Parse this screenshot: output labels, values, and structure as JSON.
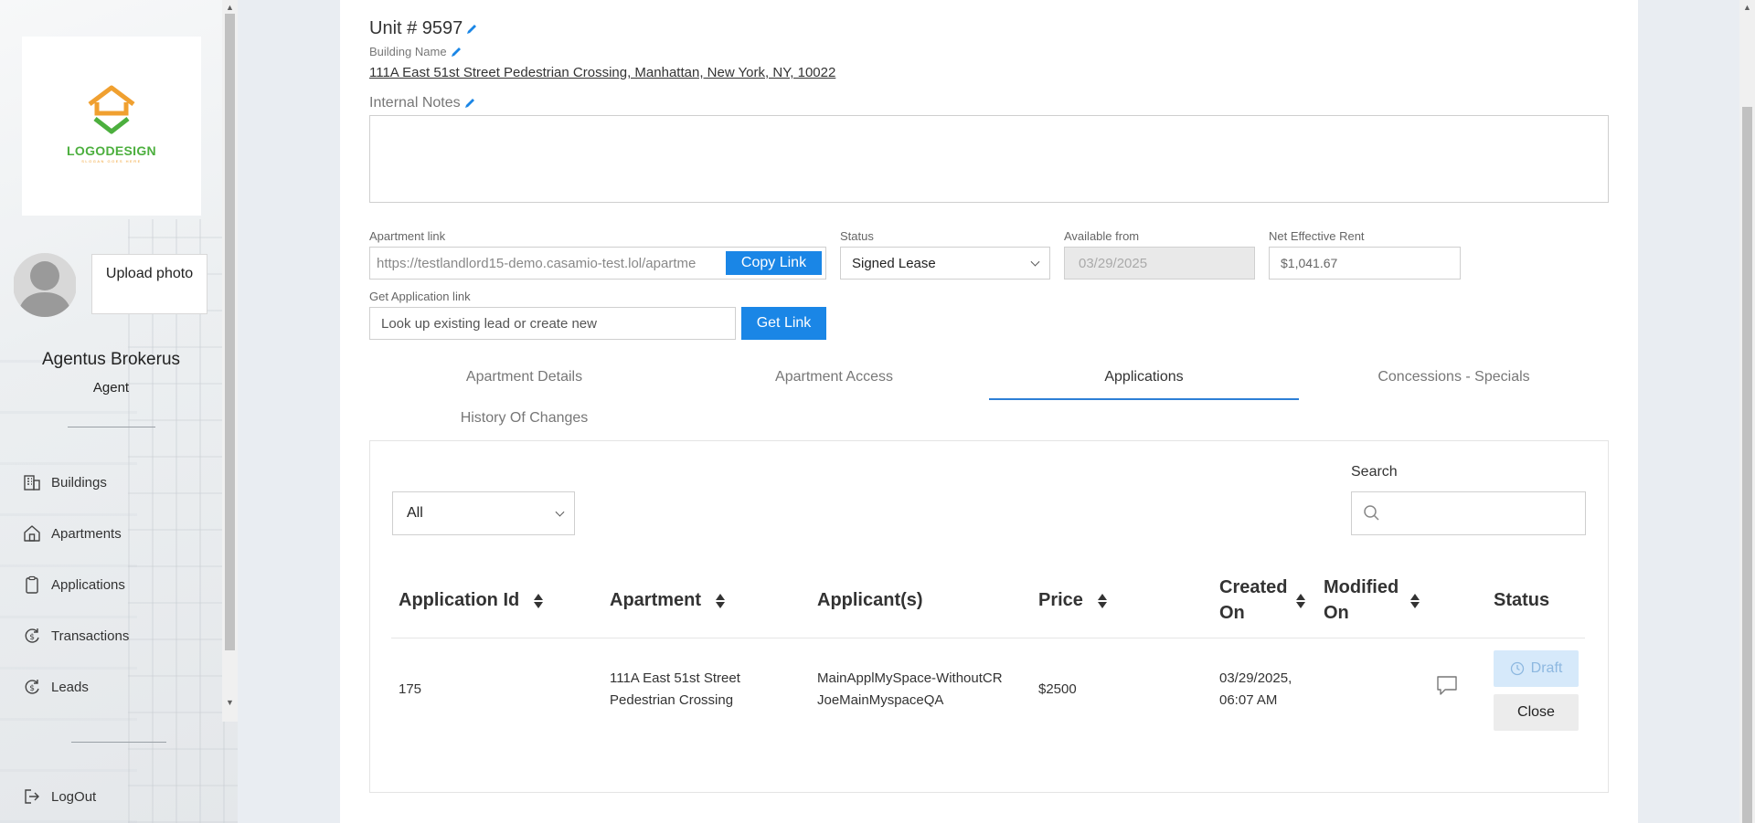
{
  "sidebar": {
    "logo": {
      "text": "LOGODESIGN",
      "slogan": "SLOGAN GOES HERE"
    },
    "upload_label": "Upload photo",
    "agent_name": "Agentus Brokerus",
    "agent_role": "Agent",
    "nav": [
      {
        "label": "Buildings",
        "icon": "building-icon"
      },
      {
        "label": "Apartments",
        "icon": "home-icon"
      },
      {
        "label": "Applications",
        "icon": "clipboard-icon"
      },
      {
        "label": "Transactions",
        "icon": "dollar-cycle-icon"
      },
      {
        "label": "Leads",
        "icon": "dollar-cycle-icon"
      }
    ],
    "logout_label": "LogOut"
  },
  "unit": {
    "title": "Unit # 9597",
    "building_name_label": "Building Name",
    "building_address": "111A East 51st Street Pedestrian Crossing, Manhattan, New York, NY, 10022",
    "notes_label": "Internal Notes",
    "notes_value": ""
  },
  "fields": {
    "apartment_link_label": "Apartment link",
    "apartment_link_value": "https://testlandlord15-demo.casamio-test.lol/apartme",
    "copy_link_label": "Copy Link",
    "status_label": "Status",
    "status_value": "Signed Lease",
    "available_label": "Available from",
    "available_value": "03/29/2025",
    "net_rent_label": "Net Effective Rent",
    "net_rent_value": "$1,041.67",
    "get_app_label": "Get Application link",
    "get_app_placeholder": "Look up existing lead or create new",
    "get_link_label": "Get Link"
  },
  "tabs": [
    {
      "label": "Apartment Details",
      "active": false
    },
    {
      "label": "Apartment Access",
      "active": false
    },
    {
      "label": "Applications",
      "active": true
    },
    {
      "label": "Concessions - Specials",
      "active": false
    },
    {
      "label": "History Of Changes",
      "active": false
    }
  ],
  "applications": {
    "filter_value": "All",
    "search_label": "Search",
    "search_value": "",
    "columns": [
      "Application Id",
      "Apartment",
      "Applicant(s)",
      "Price",
      "Created On",
      "Modified On",
      "Status"
    ],
    "rows": [
      {
        "id": "175",
        "apartment": "111A East 51st Street Pedestrian Crossing",
        "applicant_1": "MainApplMySpace-WithoutCR",
        "applicant_2": "JoeMainMyspaceQA",
        "price": "$2500",
        "created": "03/29/2025, 06:07 AM",
        "modified": "",
        "status": "Draft",
        "close_label": "Close"
      }
    ]
  },
  "colors": {
    "accent": "#1a86e6",
    "tab_underline": "#2d7fd6",
    "draft_bg": "#d6e9fa"
  }
}
